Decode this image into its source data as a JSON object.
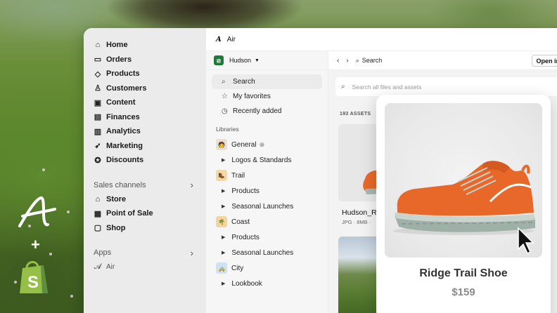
{
  "shopify_nav": {
    "items": [
      {
        "label": "Home",
        "icon": "home-icon"
      },
      {
        "label": "Orders",
        "icon": "orders-icon"
      },
      {
        "label": "Products",
        "icon": "tag-icon"
      },
      {
        "label": "Customers",
        "icon": "person-icon"
      },
      {
        "label": "Content",
        "icon": "content-icon"
      },
      {
        "label": "Finances",
        "icon": "finances-icon"
      },
      {
        "label": "Analytics",
        "icon": "analytics-icon"
      },
      {
        "label": "Marketing",
        "icon": "marketing-icon"
      },
      {
        "label": "Discounts",
        "icon": "discount-icon"
      }
    ],
    "sales_channels_label": "Sales channels",
    "sales_channels": [
      {
        "label": "Store",
        "icon": "store-icon"
      },
      {
        "label": "Point of Sale",
        "icon": "pos-icon"
      },
      {
        "label": "Shop",
        "icon": "shop-bag-icon"
      }
    ],
    "apps_label": "Apps",
    "apps": [
      {
        "label": "Air",
        "icon": "air-logo-icon"
      }
    ]
  },
  "app": {
    "title": "Air",
    "workspace": "Hudson",
    "side": {
      "search": "Search",
      "favorites": "My favorites",
      "recent": "Recently added",
      "libraries_label": "Libraries",
      "libraries": [
        {
          "name": "General",
          "emoji": "🧑",
          "children": [
            "Logos & Standards"
          ]
        },
        {
          "name": "Trail",
          "emoji": "🥾",
          "children": [
            "Products",
            "Seasonal Launches"
          ]
        },
        {
          "name": "Coast",
          "emoji": "🌴",
          "children": [
            "Products",
            "Seasonal Launches"
          ]
        },
        {
          "name": "City",
          "emoji": "🚕",
          "children": [
            "Lookbook"
          ]
        }
      ]
    },
    "main": {
      "breadcrumb_search": "Search",
      "open_in": "Open in",
      "search_placeholder": "Search all files and assets",
      "asset_count": "193 ASSETS",
      "asset_name": "Hudson_R",
      "asset_meta": "JPG · 8MB ·"
    }
  },
  "product": {
    "name": "Ridge Trail Shoe",
    "price": "$159"
  },
  "colors": {
    "shopify_green": "#95bf47",
    "workspace_green": "#1f7a3a",
    "shoe_orange": "#e8682a"
  }
}
